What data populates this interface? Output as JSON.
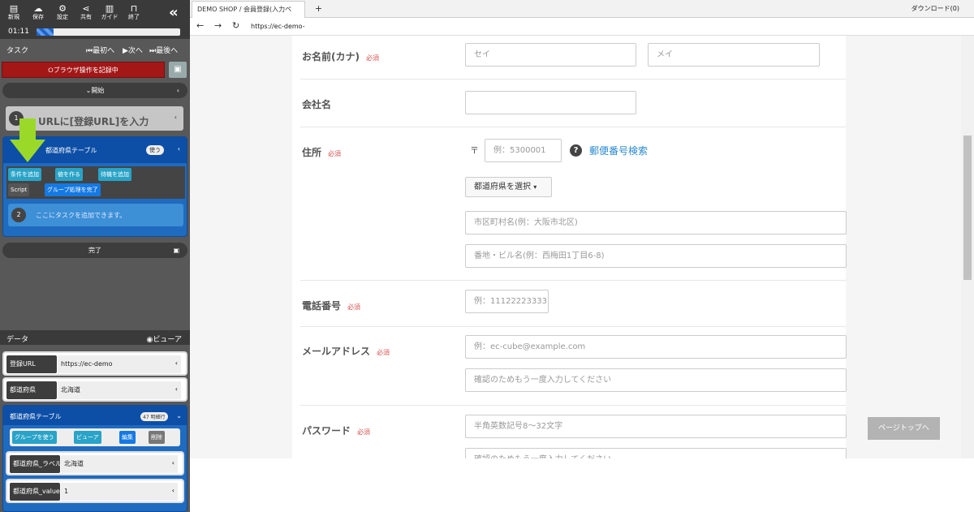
{
  "toolbar": {
    "new": "新規",
    "save": "保存",
    "settings": "設定",
    "share": "共有",
    "guide": "ガイド",
    "exit": "終了",
    "timer": "01:11"
  },
  "tasks": {
    "title": "タスク",
    "first": "最初へ",
    "next": "次へ",
    "last": "最後へ",
    "record": "ブラウザ操作を記録中",
    "start": "開始",
    "step1": "URLに[登録URL]を入力",
    "step1_num": "1",
    "table_label": "都道府県テーブル",
    "table_badge": "使う",
    "btn_cond": "条件を追加",
    "btn_value": "値を作る",
    "btn_wait": "待機を追加",
    "btn_script": "Script",
    "btn_group": "グループ処理を完了",
    "add_num": "2",
    "add_text": "ここにタスクを追加できます。",
    "finish": "完了"
  },
  "data": {
    "title": "データ",
    "viewer": "ビューア",
    "rows": [
      {
        "name": "登録URL",
        "value": "https://ec-demo"
      },
      {
        "name": "都道府県",
        "value": "北海道"
      }
    ],
    "table": {
      "name": "都道府県テーブル",
      "badge": "47 明細行",
      "use": "グループを使う",
      "view": "ビューア",
      "edit": "編集",
      "del": "削除"
    },
    "rows2": [
      {
        "name": "都道府県_ラベル",
        "value": "北海道"
      },
      {
        "name": "都道府県_value",
        "value": "1"
      }
    ]
  },
  "browser": {
    "tab": "DEMO SHOP / 会員登録(入力ペ",
    "new_tab": "+",
    "download": "ダウンロード(0)",
    "url": "https://ec-demo-"
  },
  "form": {
    "required": "必須",
    "kana_label": "お名前(カナ)",
    "kana_sei": "セイ",
    "kana_mei": "メイ",
    "company_label": "会社名",
    "addr_label": "住所",
    "zip_mark": "〒",
    "zip_ph": "例：5300001",
    "zip_search": "郵便番号検索",
    "pref_select": "都道府県を選択",
    "city_ph": "市区町村名(例：大阪市北区)",
    "street_ph": "番地・ビル名(例：西梅田1丁目6-8)",
    "tel_label": "電話番号",
    "tel_ph": "例：11122223333",
    "mail_label": "メールアドレス",
    "mail_ph": "例：ec-cube@example.com",
    "mail_confirm_ph": "確認のためもう一度入力してください",
    "pass_label": "パスワード",
    "pass_ph": "半角英数記号8〜32文字",
    "pass_confirm_ph": "確認のためもう一度入力してください",
    "page_top": "ページトップへ"
  }
}
